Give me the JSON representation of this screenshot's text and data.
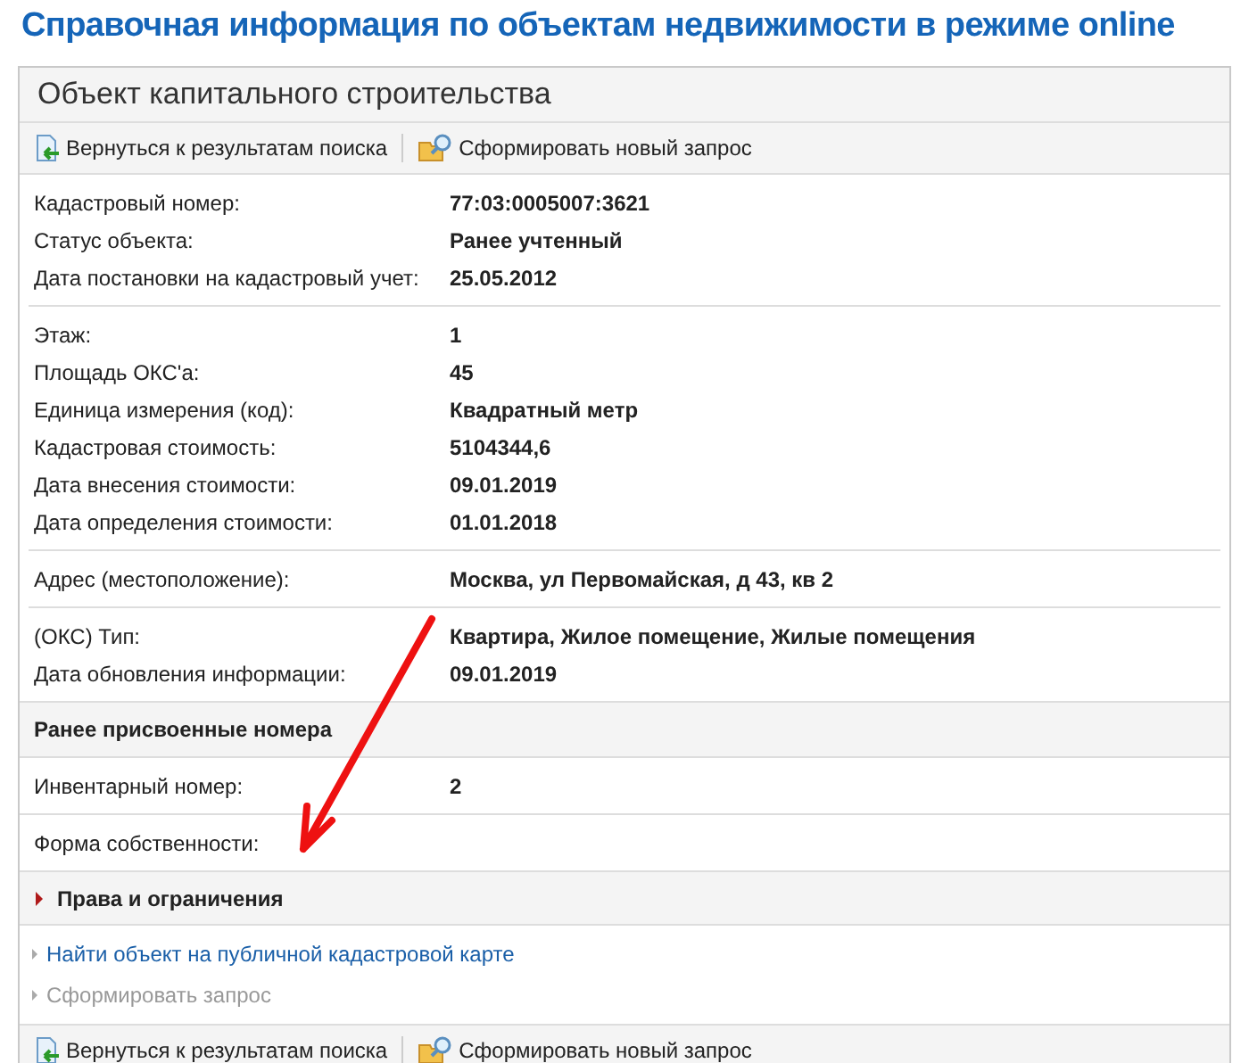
{
  "page_title": "Справочная информация по объектам недвижимости в режиме online",
  "panel": {
    "title": "Объект капитального строительства",
    "toolbar": [
      {
        "kind": "back",
        "label": "Вернуться к результатам поиска"
      },
      {
        "kind": "new",
        "label": "Сформировать новый запрос"
      }
    ],
    "blocks": [
      {
        "kind": "group",
        "rows": [
          {
            "label": "Кадастровый номер:",
            "value": "77:03:0005007:3621"
          },
          {
            "label": "Статус объекта:",
            "value": "Ранее учтенный"
          },
          {
            "label": "Дата постановки на кадастровый учет:",
            "value": "25.05.2012"
          }
        ]
      },
      {
        "kind": "group",
        "rows": [
          {
            "label": "Этаж:",
            "value": "1"
          },
          {
            "label": "Площадь ОКС'a:",
            "value": "45"
          },
          {
            "label": "Единица измерения (код):",
            "value": "Квадратный метр"
          },
          {
            "label": "Кадастровая стоимость:",
            "value": "5104344,6"
          },
          {
            "label": "Дата внесения стоимости:",
            "value": "09.01.2019"
          },
          {
            "label": "Дата определения стоимости:",
            "value": "01.01.2018"
          }
        ]
      },
      {
        "kind": "group",
        "rows": [
          {
            "label": "Адрес (местоположение):",
            "value": "Москва, ул Первомайская, д 43, кв 2"
          }
        ]
      },
      {
        "kind": "group",
        "rows": [
          {
            "label": "(ОКС) Тип:",
            "value": "Квартира, Жилое помещение, Жилые помещения"
          },
          {
            "label": "Дата обновления информации:",
            "value": "09.01.2019"
          }
        ]
      },
      {
        "kind": "subheader",
        "title": "Ранее присвоенные номера"
      },
      {
        "kind": "boxed",
        "rows": [
          {
            "label": "Инвентарный номер:",
            "value": "2"
          }
        ]
      },
      {
        "kind": "boxed",
        "rows": [
          {
            "label": "Форма собственности:"
          }
        ]
      },
      {
        "kind": "collapsible",
        "title": "Права и ограничения",
        "expanded": false
      },
      {
        "kind": "links",
        "links": [
          {
            "label": "Найти объект на публичной кадастровой карте",
            "disabled": false
          },
          {
            "label": "Сформировать запрос",
            "disabled": true
          }
        ]
      }
    ],
    "footer_toolbar": [
      {
        "kind": "back",
        "label": "Вернуться к результатам поиска"
      },
      {
        "kind": "new",
        "label": "Сформировать новый запрос"
      }
    ]
  }
}
